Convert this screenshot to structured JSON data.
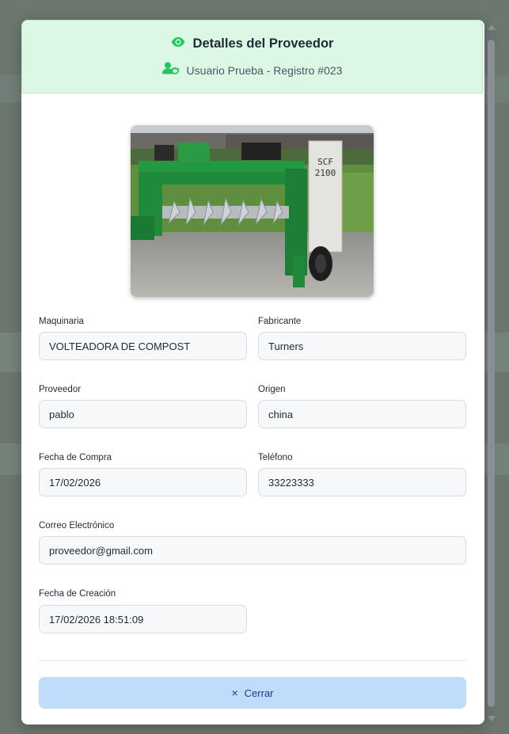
{
  "header": {
    "title": "Detalles del Proveedor",
    "subtitle": "Usuario Prueba - Registro #023",
    "title_icon": "eye-icon",
    "subtitle_icon": "user-shield-icon",
    "accent_color": "#22c55e",
    "background_color": "#dcf7e3"
  },
  "image": {
    "description_icon": "machinery-photo",
    "plate_text": "SCF 2100"
  },
  "fields": {
    "maquinaria": {
      "label": "Maquinaria",
      "value": "VOLTEADORA DE COMPOST"
    },
    "fabricante": {
      "label": "Fabricante",
      "value": "Turners"
    },
    "proveedor": {
      "label": "Proveedor",
      "value": "pablo"
    },
    "origen": {
      "label": "Origen",
      "value": "china"
    },
    "fecha_compra": {
      "label": "Fecha de Compra",
      "value": "17/02/2026"
    },
    "telefono": {
      "label": "Teléfono",
      "value": "33223333"
    },
    "correo": {
      "label": "Correo Electrónico",
      "value": "proveedor@gmail.com"
    },
    "fecha_creacion": {
      "label": "Fecha de Creación",
      "value": "17/02/2026 18:51:09"
    }
  },
  "actions": {
    "close_label": "Cerrar",
    "close_icon": "×",
    "close_color": "#bfdcfb"
  }
}
